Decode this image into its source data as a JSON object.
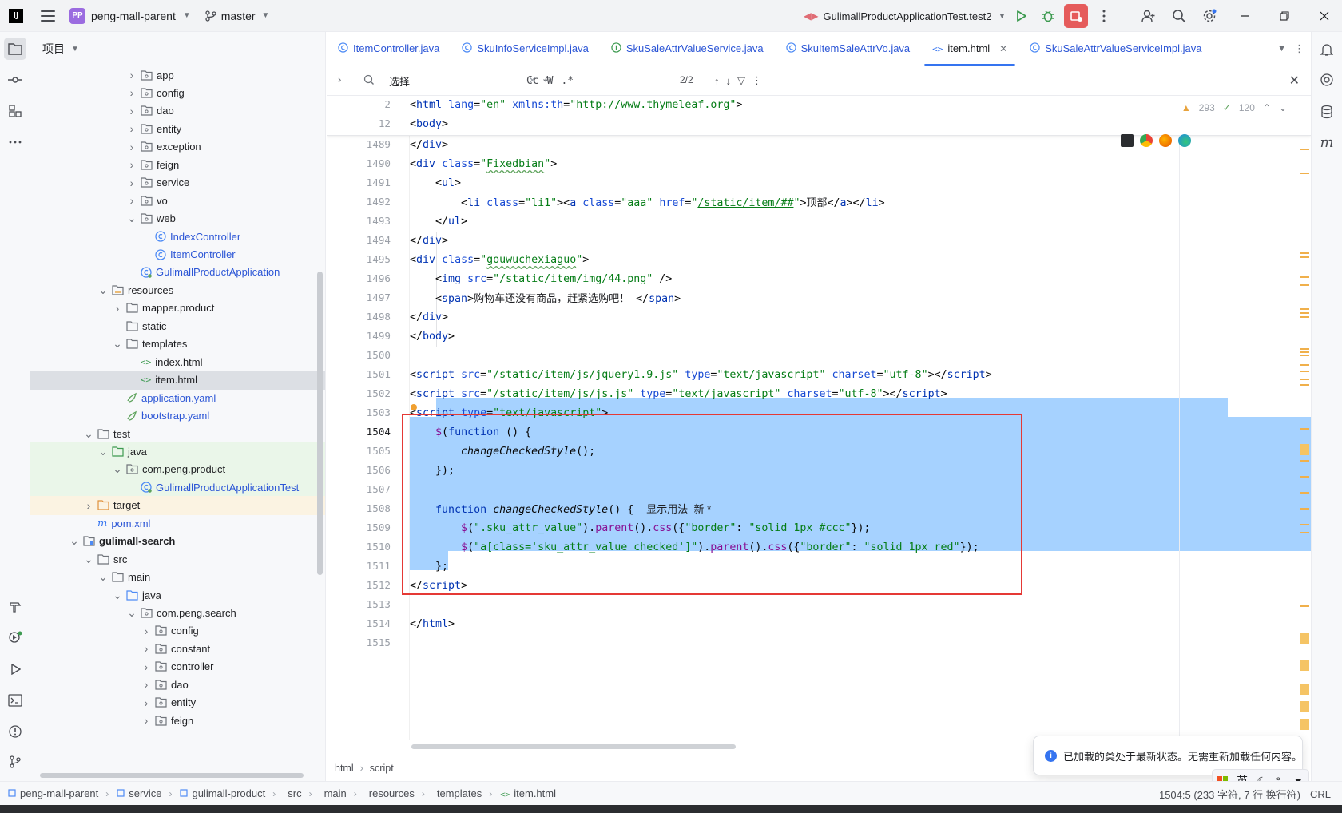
{
  "titlebar": {
    "project_badge": "PP",
    "project_name": "peng-mall-parent",
    "branch": "master",
    "run_config": "GulimallProductApplicationTest.test2"
  },
  "project_panel": {
    "title": "项目",
    "rows": [
      {
        "label": "app",
        "kind": "package"
      },
      {
        "label": "config",
        "kind": "package"
      },
      {
        "label": "dao",
        "kind": "package"
      },
      {
        "label": "entity",
        "kind": "package"
      },
      {
        "label": "exception",
        "kind": "package"
      },
      {
        "label": "feign",
        "kind": "package"
      },
      {
        "label": "service",
        "kind": "package"
      },
      {
        "label": "vo",
        "kind": "package"
      },
      {
        "label": "web",
        "kind": "package"
      },
      {
        "label": "IndexController",
        "kind": "class"
      },
      {
        "label": "ItemController",
        "kind": "class"
      },
      {
        "label": "GulimallProductApplication",
        "kind": "spring-class"
      },
      {
        "label": "resources",
        "kind": "res-folder"
      },
      {
        "label": "mapper.product",
        "kind": "folder"
      },
      {
        "label": "static",
        "kind": "folder"
      },
      {
        "label": "templates",
        "kind": "folder"
      },
      {
        "label": "index.html",
        "kind": "html"
      },
      {
        "label": "item.html",
        "kind": "html"
      },
      {
        "label": "application.yaml",
        "kind": "yaml"
      },
      {
        "label": "bootstrap.yaml",
        "kind": "yaml"
      },
      {
        "label": "test",
        "kind": "folder"
      },
      {
        "label": "java",
        "kind": "test-folder"
      },
      {
        "label": "com.peng.product",
        "kind": "package"
      },
      {
        "label": "GulimallProductApplicationTest",
        "kind": "spring-class"
      },
      {
        "label": "target",
        "kind": "target-folder"
      },
      {
        "label": "pom.xml",
        "kind": "maven"
      },
      {
        "label": "gulimall-search",
        "kind": "module"
      },
      {
        "label": "src",
        "kind": "folder"
      },
      {
        "label": "main",
        "kind": "folder"
      },
      {
        "label": "java",
        "kind": "src-folder"
      },
      {
        "label": "com.peng.search",
        "kind": "package"
      },
      {
        "label": "config",
        "kind": "package"
      },
      {
        "label": "constant",
        "kind": "package"
      },
      {
        "label": "controller",
        "kind": "package"
      },
      {
        "label": "dao",
        "kind": "package"
      },
      {
        "label": "entity",
        "kind": "package"
      },
      {
        "label": "feign",
        "kind": "package"
      }
    ]
  },
  "tabs": [
    {
      "label": "ItemController.java",
      "icon": "java-class-icon"
    },
    {
      "label": "SkuInfoServiceImpl.java",
      "icon": "java-class-icon"
    },
    {
      "label": "SkuSaleAttrValueService.java",
      "icon": "java-interface-icon"
    },
    {
      "label": "SkuItemSaleAttrVo.java",
      "icon": "java-class-icon"
    },
    {
      "label": "item.html",
      "icon": "html-icon",
      "active": true
    },
    {
      "label": "SkuSaleAttrValueServiceImpl.java",
      "icon": "java-class-icon"
    }
  ],
  "find": {
    "query": "选择",
    "case_label": "Cc",
    "word_label": "W",
    "regex_label": ".*",
    "count": "2/2"
  },
  "inspection": {
    "warnings": "293",
    "weak_warnings": "120"
  },
  "code": {
    "sticky_lines": [
      "2",
      "12"
    ],
    "line_numbers": [
      "1489",
      "1490",
      "1491",
      "1492",
      "1493",
      "1494",
      "1495",
      "1496",
      "1497",
      "1498",
      "1499",
      "1500",
      "1501",
      "1502",
      "1503",
      "1504",
      "1505",
      "1506",
      "1507",
      "1508",
      "1509",
      "1510",
      "1511",
      "1512",
      "1513",
      "1514",
      "1515"
    ],
    "text": {
      "sticky2_tag": "html",
      "sticky2_attr1": "lang",
      "sticky2_val1": "\"en\"",
      "sticky2_attr2": "xmlns:th",
      "sticky2_val2": "\"http://www.thymeleaf.org\"",
      "sticky12_tag": "body",
      "l1492_text": "顶部",
      "l1496_src": "\"/static/item/img/44.png\"",
      "l1497_text": "购物车还没有商品，赶紧选购吧！",
      "l1501_src": "\"/static/item/js/jquery1.9.js\"",
      "l1502_src": "\"/static/item/js/js.js\"",
      "l1508_hint": "显示用法  新 *",
      "l1509_sel": "\".sku_attr_value\"",
      "l1509_css": "\"solid 1px #ccc\"",
      "l1510_sel": "\"a[class='sku_attr_value checked']\"",
      "l1510_css": "\"solid 1px red\""
    }
  },
  "editor_breadcrumb": [
    "html",
    "script"
  ],
  "notification": "已加载的类处于最新状态。无需重新加载任何内容。",
  "ime": {
    "lang": "英"
  },
  "statusbar": {
    "path": [
      "peng-mall-parent",
      "service",
      "gulimall-product",
      "src",
      "main",
      "resources",
      "templates",
      "item.html"
    ],
    "position": "1504:5 (233 字符, 7 行 换行符)",
    "line_ending": "CRL"
  },
  "colors": {
    "accent": "#3574f0",
    "selection": "#a6d2ff",
    "highlight_box": "#e53935",
    "stop": "#e55b5b"
  }
}
